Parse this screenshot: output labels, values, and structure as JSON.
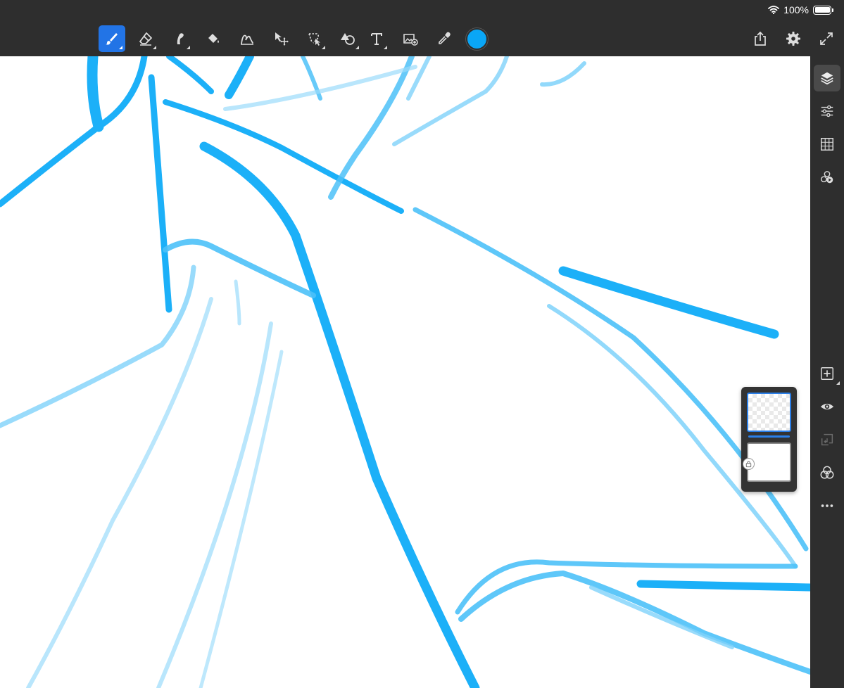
{
  "status_bar": {
    "battery_text": "100%",
    "wifi_icon": "wifi-icon",
    "battery_icon": "battery-icon"
  },
  "toolbar": {
    "tools": [
      {
        "id": "brush",
        "icon": "brush-icon",
        "active": true
      },
      {
        "id": "eraser",
        "icon": "eraser-icon",
        "active": false
      },
      {
        "id": "smudge",
        "icon": "smudge-icon",
        "active": false
      },
      {
        "id": "fill",
        "icon": "fill-bucket-icon",
        "active": false
      },
      {
        "id": "liquify",
        "icon": "liquify-icon",
        "active": false
      },
      {
        "id": "transform",
        "icon": "transform-icon",
        "active": false
      },
      {
        "id": "selection",
        "icon": "lasso-selection-icon",
        "active": false
      },
      {
        "id": "shape",
        "icon": "shape-icon",
        "active": false
      },
      {
        "id": "text",
        "icon": "text-icon",
        "active": false
      },
      {
        "id": "image",
        "icon": "image-add-icon",
        "active": false
      },
      {
        "id": "eyedropper",
        "icon": "eyedropper-icon",
        "active": false
      }
    ],
    "current_color": "#0aa6f6",
    "right_actions": [
      "share-icon",
      "settings-icon",
      "fullscreen-icon"
    ]
  },
  "sidebar": {
    "top": [
      "layers-icon",
      "adjustments-icon",
      "grid-icon",
      "timelapse-icon"
    ],
    "bottom": [
      "add-layer-icon",
      "visibility-icon",
      "merge-down-icon",
      "blend-mode-icon",
      "more-icon"
    ]
  },
  "layers": {
    "count": 2,
    "selected_index": 0
  },
  "colors": {
    "chrome": "#2e2e2e",
    "accent": "#2274e6",
    "stroke": "#0aa6f6"
  }
}
